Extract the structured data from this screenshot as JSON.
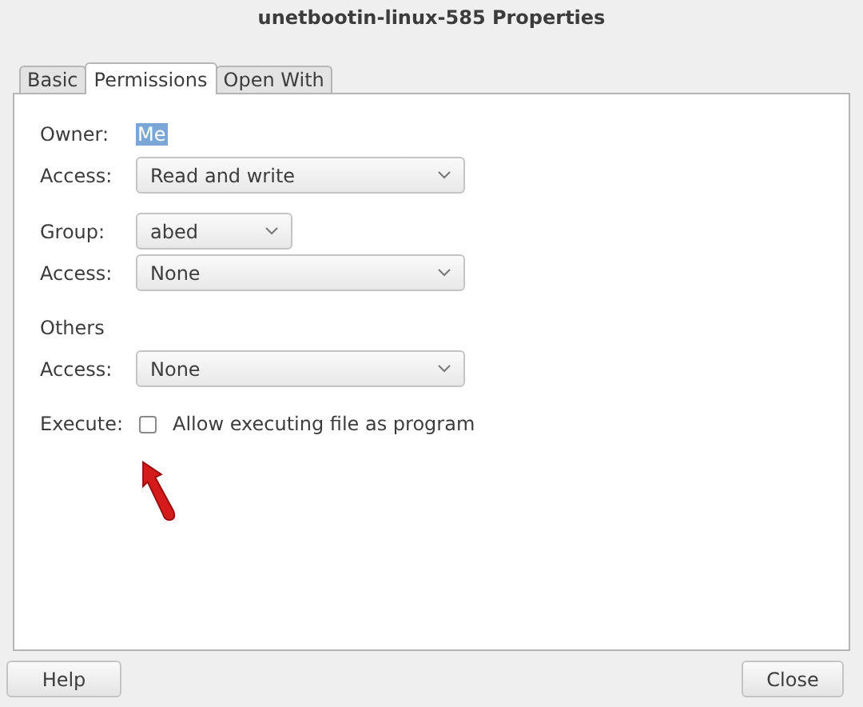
{
  "window": {
    "title": "unetbootin-linux-585 Properties"
  },
  "tabs": [
    {
      "label": "Basic",
      "selected": false
    },
    {
      "label": "Permissions",
      "selected": true
    },
    {
      "label": "Open With",
      "selected": false
    }
  ],
  "sections": [
    {
      "rows": [
        {
          "kind": "value",
          "label": "Owner:",
          "value": "Me",
          "selected": true
        },
        {
          "kind": "dropdown",
          "label": "Access:",
          "value": "Read and write"
        }
      ]
    },
    {
      "rows": [
        {
          "kind": "short-dropdown",
          "label": "Group:",
          "value": "abed"
        },
        {
          "kind": "dropdown",
          "label": "Access:",
          "value": "None"
        }
      ]
    },
    {
      "rows": [
        {
          "kind": "heading",
          "label": "Others"
        },
        {
          "kind": "dropdown",
          "label": "Access:",
          "value": "None"
        }
      ]
    },
    {
      "rows": [
        {
          "kind": "checkbox",
          "label": "Execute:",
          "value": "Allow executing file as program",
          "checked": false
        }
      ]
    }
  ],
  "buttons": [
    "Help",
    "Close"
  ]
}
